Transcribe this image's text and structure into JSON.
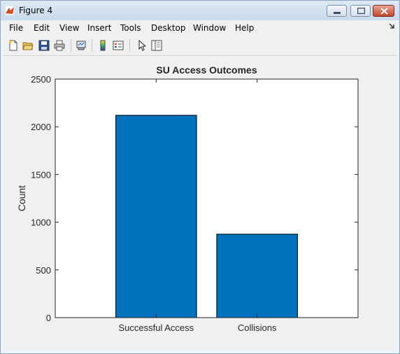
{
  "window": {
    "title": "Figure 4",
    "colors": {
      "titlebar": "#c9d9ec",
      "close": "#c5432c"
    }
  },
  "menu": {
    "items": [
      "File",
      "Edit",
      "View",
      "Insert",
      "Tools",
      "Desktop",
      "Window",
      "Help"
    ]
  },
  "toolbar": {
    "icons": [
      "new-figure-icon",
      "open-file-icon",
      "save-icon",
      "print-icon",
      "link-plot-icon",
      "colorbar-icon",
      "legend-icon",
      "select-arrow-icon",
      "property-inspector-icon"
    ]
  },
  "chart_data": {
    "type": "bar",
    "title": "SU Access Outcomes",
    "xlabel": "",
    "ylabel": "Count",
    "categories": [
      "Successful Access",
      "Collisions"
    ],
    "values": [
      2120,
      875
    ],
    "ylim": [
      0,
      2500
    ],
    "yticks": [
      0,
      500,
      1000,
      1500,
      2000,
      2500
    ],
    "bar_color": "#0072bd",
    "grid": false
  }
}
